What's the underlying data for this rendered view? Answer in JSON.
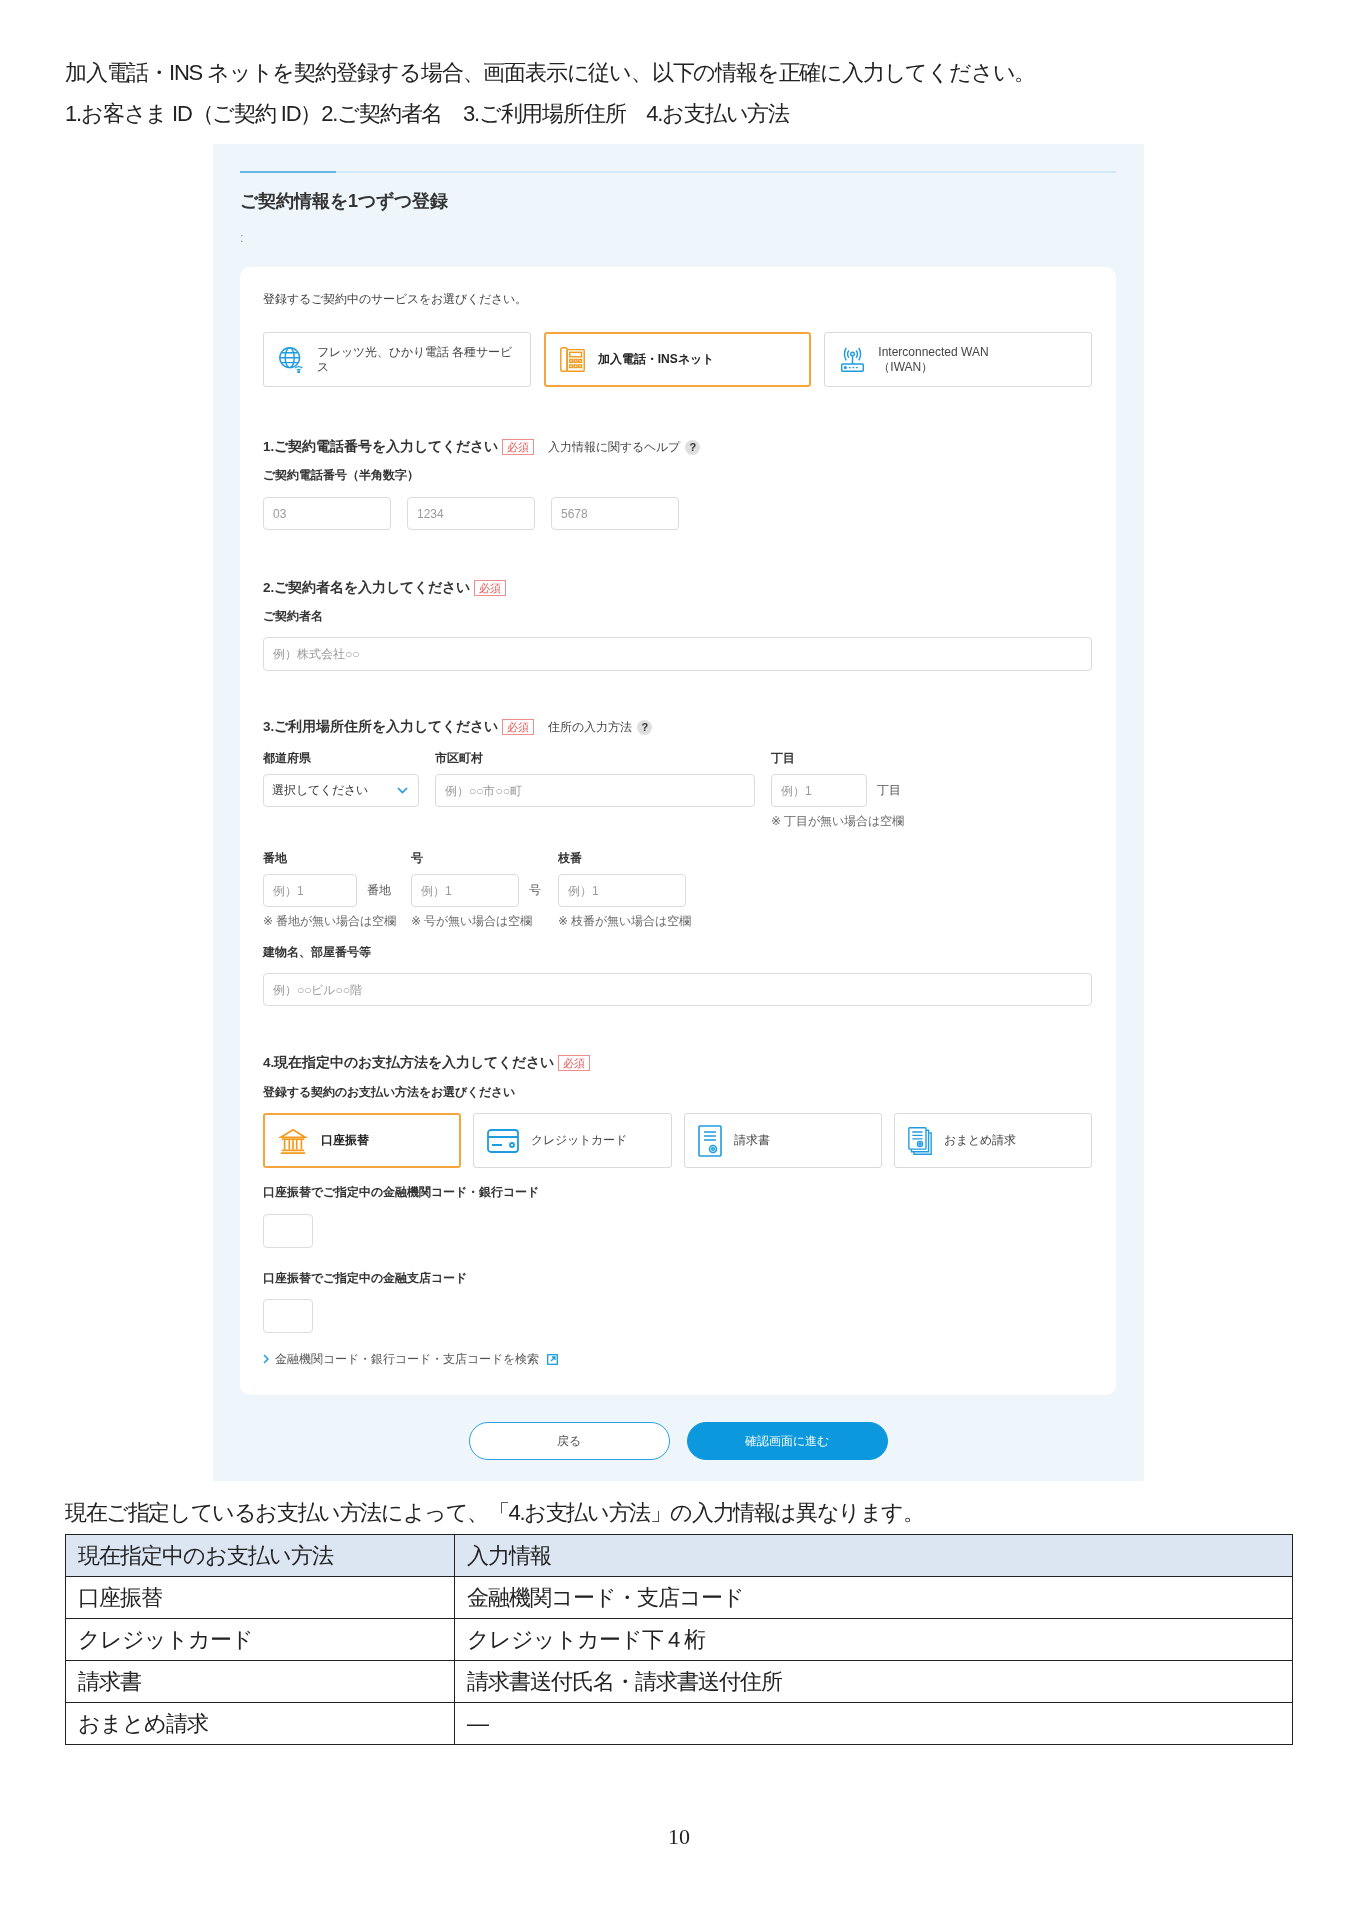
{
  "intro": {
    "lines": [
      "加入電話・INS ネットを契約登録する場合、画面表示に従い、以下の情報を正確に入力してください。",
      "1.お客さま ID（ご契約 ID）2.ご契約者名　3.ご利用場所住所　4.お支払い方法"
    ]
  },
  "screen": {
    "progress": {
      "level": 0.11
    },
    "title": "ご契約情報を1つずつ登録",
    "breadcrumb": ":",
    "service_prompt": "登録するご契約中のサービスをお選びください。",
    "services": [
      {
        "label": "フレッツ光、ひかり電話 各種サービス",
        "selected": false
      },
      {
        "label": "加入電話・INSネット",
        "selected": true
      },
      {
        "label": "Interconnected WAN\n（IWAN）",
        "selected": false
      }
    ],
    "phone_section": {
      "heading": "1.ご契約電話番号を入力してください",
      "badge": "必須",
      "help": "入力情報に関するヘルプ",
      "help_mark": "?",
      "field_label": "ご契約電話番号（半角数字）",
      "inputs": [
        {
          "placeholder": "03"
        },
        {
          "placeholder": "1234"
        },
        {
          "placeholder": "5678"
        }
      ]
    },
    "name_section": {
      "heading": "2.ご契約者名を入力してください",
      "badge": "必須",
      "field_label": "ご契約者名",
      "input": {
        "placeholder": "例）株式会社○○"
      }
    },
    "address_section": {
      "heading": "3.ご利用場所住所を入力してください",
      "badge": "必須",
      "help": "住所の入力方法",
      "help_mark": "?",
      "rows": [
        [
          {
            "kind": "select",
            "label": "都道府県",
            "value": "選択してください"
          },
          {
            "kind": "text",
            "label": "市区町村",
            "placeholder": "例）○○市○○町"
          },
          {
            "kind": "text",
            "label": "丁目",
            "placeholder": "例）1",
            "suffix": "丁目",
            "note": "※ 丁目が無い場合は空欄"
          }
        ],
        [
          {
            "kind": "text",
            "label": "番地",
            "placeholder": "例）1",
            "suffix": "番地",
            "note": "※ 番地が無い場合は空欄"
          },
          {
            "kind": "text",
            "label": "号",
            "placeholder": "例）1",
            "suffix": "号",
            "note": "※ 号が無い場合は空欄"
          },
          {
            "kind": "text",
            "label": "枝番",
            "placeholder": "例）1",
            "note": "※ 枝番が無い場合は空欄"
          }
        ]
      ],
      "building": {
        "label": "建物名、部屋番号等",
        "placeholder": "例）○○ビル○○階"
      }
    },
    "payment_section": {
      "heading": "4.現在指定中のお支払方法を入力してください",
      "badge": "必須",
      "prompt": "登録する契約のお支払い方法をお選びください",
      "options": [
        {
          "label": "口座振替",
          "selected": true
        },
        {
          "label": "クレジットカード",
          "selected": false
        },
        {
          "label": "請求書",
          "selected": false
        },
        {
          "label": "おまとめ請求",
          "selected": false
        }
      ],
      "fields": [
        {
          "label": "口座振替でご指定中の金融機関コード・銀行コード"
        },
        {
          "label": "口座振替でご指定中の金融支店コード"
        }
      ],
      "link": "金融機関コード・銀行コード・支店コードを検索"
    },
    "buttons": [
      {
        "label": "戻る",
        "kind": "secondary"
      },
      {
        "label": "確認画面に進む",
        "kind": "primary"
      }
    ]
  },
  "caption": "現在ご指定しているお支払い方法によって、「4.お支払い方法」の入力情報は異なります。",
  "table": {
    "columns": [
      "現在指定中のお支払い方法",
      "入力情報"
    ],
    "rows": [
      [
        "口座振替",
        "金融機関コード・支店コード"
      ],
      [
        "クレジットカード",
        "クレジットカード下 4 桁"
      ],
      [
        "請求書",
        "請求書送付氏名・請求書送付住所"
      ],
      [
        "おまとめ請求",
        "—"
      ]
    ]
  },
  "page_number": "10"
}
